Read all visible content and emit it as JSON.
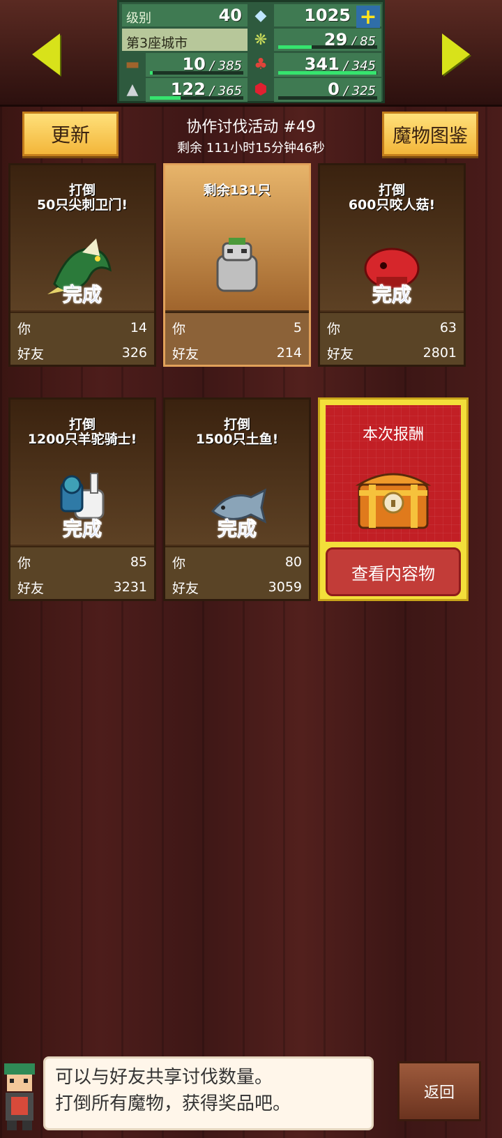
{
  "hud": {
    "level_label": "级别",
    "level_value": "40",
    "gems": "1025",
    "city_label": "第3座城市",
    "wood": {
      "current": "10",
      "max": "385",
      "fraction": 0.03
    },
    "stone": {
      "current": "122",
      "max": "365",
      "fraction": 0.33
    },
    "crop": {
      "current": "29",
      "max": "85",
      "fraction": 0.34
    },
    "food": {
      "current": "341",
      "max": "345",
      "fraction": 0.99
    },
    "crystal": {
      "current": "0",
      "max": "325",
      "fraction": 0.0
    }
  },
  "header": {
    "refresh_label": "更新",
    "title": "协作讨伐活动 #49",
    "remaining": "剩余 111小时15分钟46秒",
    "bestiary_label": "魔物图鉴"
  },
  "cards": [
    {
      "goal": "打倒\n50只尖刺卫门!",
      "done": "完成",
      "you_label": "你",
      "you": "14",
      "friend_label": "好友",
      "friend": "326",
      "monster": "dragon-icon"
    },
    {
      "goal": "剩余131只",
      "done": "",
      "you_label": "你",
      "you": "5",
      "friend_label": "好友",
      "friend": "214",
      "monster": "stone-golem-icon"
    },
    {
      "goal": "打倒\n600只咬人菇!",
      "done": "完成",
      "you_label": "你",
      "you": "63",
      "friend_label": "好友",
      "friend": "2801",
      "monster": "red-mushroom-icon"
    },
    {
      "goal": "打倒\n1200只羊驼骑士!",
      "done": "完成",
      "you_label": "你",
      "you": "85",
      "friend_label": "好友",
      "friend": "3231",
      "monster": "alpaca-knight-icon"
    },
    {
      "goal": "打倒\n1500只土鱼!",
      "done": "完成",
      "you_label": "你",
      "you": "80",
      "friend_label": "好友",
      "friend": "3059",
      "monster": "mud-fish-icon"
    }
  ],
  "reward": {
    "title": "本次报酬",
    "view_label": "查看内容物"
  },
  "footer": {
    "tip_line1": "可以与好友共享讨伐数量。",
    "tip_line2": "打倒所有魔物，获得奖品吧。",
    "back_label": "返回"
  },
  "colors": {
    "accent_gold": "#f3b63a",
    "done_blue": "#2f5de0",
    "reward_red": "#c21f25"
  }
}
